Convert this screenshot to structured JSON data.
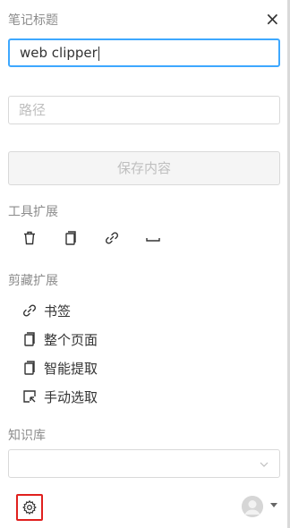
{
  "header": {
    "title_label": "笔记标题",
    "close_glyph": "×"
  },
  "title_input": {
    "value": "web clipper"
  },
  "path_input": {
    "placeholder": "路径"
  },
  "save_button": {
    "label": "保存内容"
  },
  "tools": {
    "label": "工具扩展",
    "icons": [
      "trash-icon",
      "copy-icon",
      "link-icon",
      "minus-icon"
    ]
  },
  "clip": {
    "label": "剪藏扩展",
    "items": [
      {
        "icon": "link-icon",
        "label": "书签"
      },
      {
        "icon": "page-icon",
        "label": "整个页面"
      },
      {
        "icon": "page-icon",
        "label": "智能提取"
      },
      {
        "icon": "select-icon",
        "label": "手动选取"
      }
    ]
  },
  "knowledge_base": {
    "label": "知识库",
    "selected": ""
  },
  "footer": {
    "settings_icon": "gear-icon",
    "avatar_icon": "avatar",
    "menu_icon": "caret-down-icon"
  }
}
